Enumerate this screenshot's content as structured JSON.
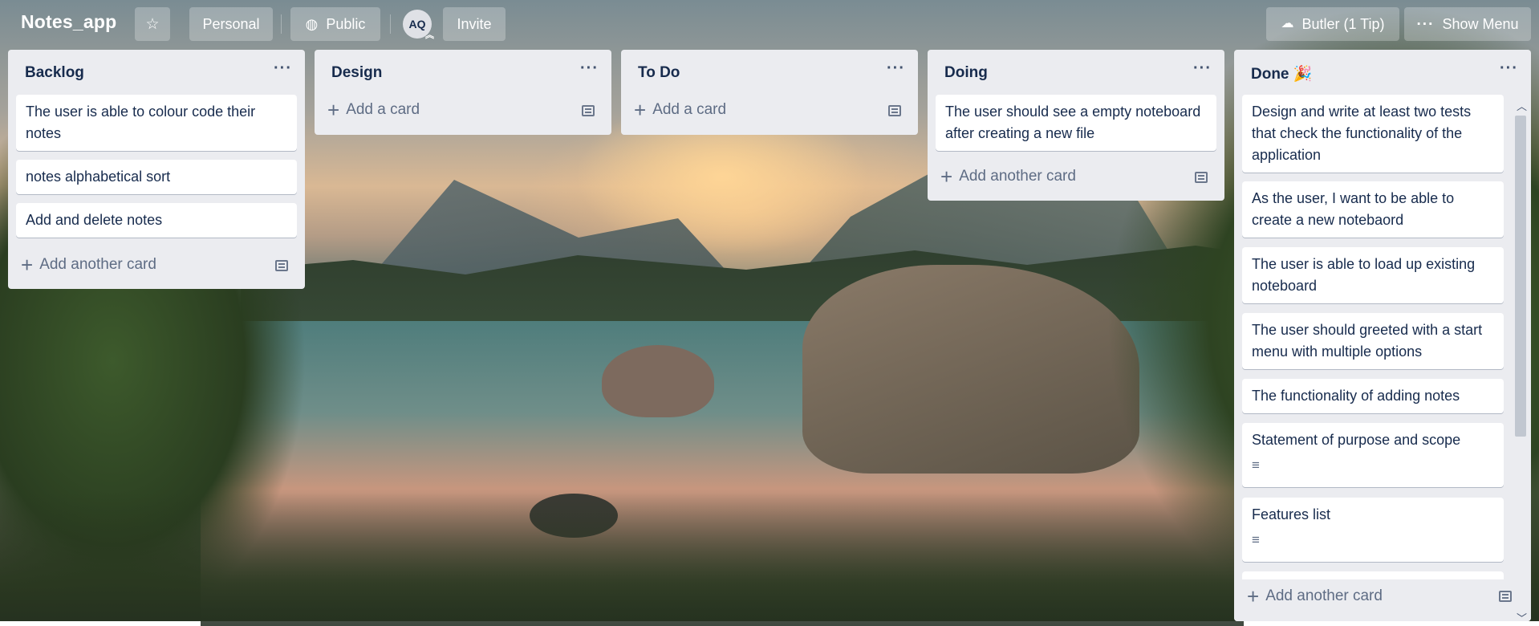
{
  "header": {
    "board_title": "Notes_app",
    "star_glyph": "☆",
    "personal_label": "Personal",
    "public_label": "Public",
    "public_icon": "globe-icon",
    "avatar_initials": "AQ",
    "invite_label": "Invite",
    "butler_label": "Butler (1 Tip)",
    "butler_icon": "butler-icon",
    "menu_label": "Show Menu",
    "menu_glyph": "···"
  },
  "list_menu_glyph": "···",
  "add_plus": "+",
  "lists": [
    {
      "title": "Backlog",
      "cards": [
        "The user is able to colour code their notes",
        "notes alphabetical sort",
        "Add and delete notes"
      ],
      "add_label": "Add another card"
    },
    {
      "title": "Design",
      "cards": [],
      "add_label": "Add a card"
    },
    {
      "title": "To Do",
      "cards": [],
      "add_label": "Add a card"
    },
    {
      "title": "Doing",
      "cards": [
        "The user should see a empty noteboard after creating a new file"
      ],
      "add_label": "Add another card"
    },
    {
      "title": "Done 🎉",
      "cards": [
        "Design and write at least two tests that check the functionality of the application",
        "As the user, I want to be able to create a new notebaord",
        "The user is able to load up existing noteboard",
        "The user should greeted with a start menu with multiple options",
        "The functionality of adding notes",
        "Statement of purpose and scope",
        "Features list"
      ],
      "add_label": "Add another card"
    }
  ],
  "desc_glyph": "≡",
  "scroll_up": "︿",
  "scroll_down": "﹀"
}
